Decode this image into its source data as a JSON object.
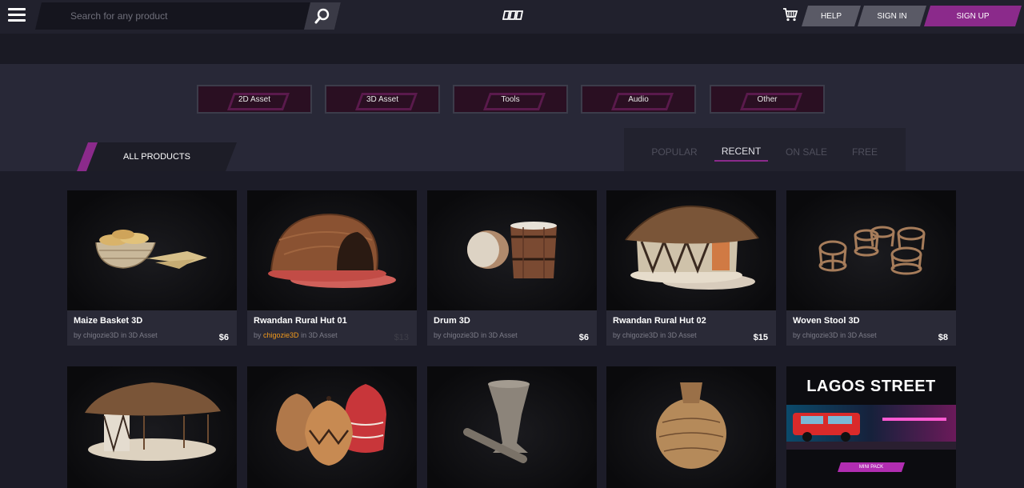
{
  "header": {
    "search_placeholder": "Search for any product",
    "help_label": "HELP",
    "signin_label": "SIGN IN",
    "signup_label": "SIGN UP"
  },
  "categories": [
    "2D Asset",
    "3D Asset",
    "Tools",
    "Audio",
    "Other"
  ],
  "section": {
    "all_products_label": "ALL PRODUCTS",
    "filters": [
      "POPULAR",
      "RECENT",
      "ON SALE",
      "FREE"
    ],
    "active_filter": "RECENT"
  },
  "products": [
    {
      "title": "Maize Basket 3D",
      "by": "by",
      "author": "chigozie3D",
      "in": "in 3D Asset",
      "price": "$6"
    },
    {
      "title": "Rwandan Rural Hut 01",
      "by": "by",
      "author": "chigozie3D",
      "in": "in 3D Asset",
      "price": "$13"
    },
    {
      "title": "Drum 3D",
      "by": "by",
      "author": "chigozie3D",
      "in": "in 3D Asset",
      "price": "$6"
    },
    {
      "title": "Rwandan Rural Hut 02",
      "by": "by",
      "author": "chigozie3D",
      "in": "in 3D Asset",
      "price": "$15"
    },
    {
      "title": "Woven Stool 3D",
      "by": "by",
      "author": "chigozie3D",
      "in": "in 3D Asset",
      "price": "$8"
    }
  ],
  "banner": {
    "title": "LAGOS STREET",
    "tag": "MINI PACK"
  },
  "colors": {
    "accent": "#8b2a8b",
    "author_highlight": "#f29a1c",
    "background": "#1c1c28"
  },
  "icons": [
    "menu-icon",
    "search-icon",
    "logo-icon",
    "cart-icon"
  ]
}
